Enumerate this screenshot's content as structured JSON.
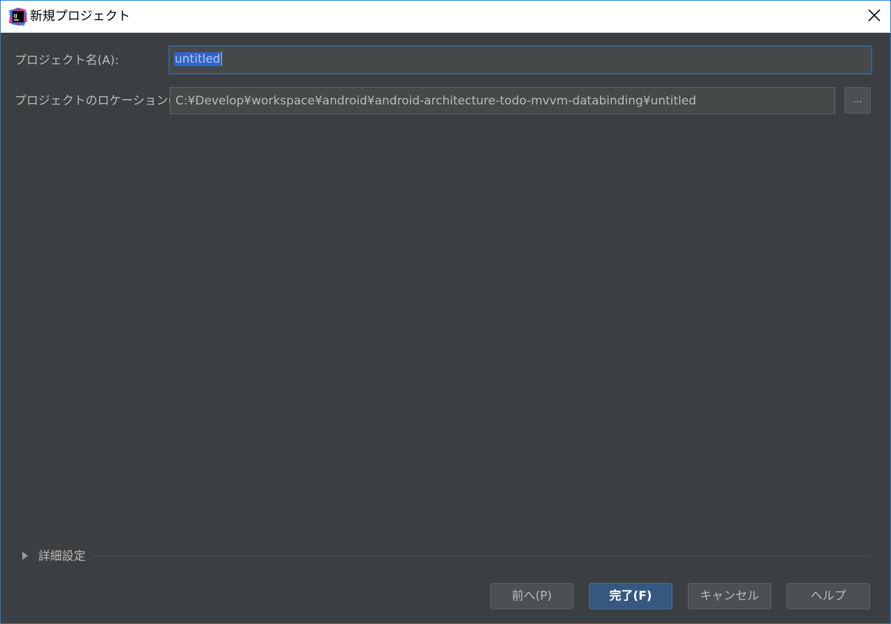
{
  "window": {
    "title": "新規プロジェクト",
    "app_icon_text": "IJ",
    "close_symbol": "✕"
  },
  "form": {
    "project_name": {
      "label": "プロジェクト名(A):",
      "value": "untitled"
    },
    "project_location": {
      "label": "プロジェクトのロケーション(L):",
      "value": "C:¥Develop¥workspace¥android¥android-architecture-todo-mvvm-databinding¥untitled",
      "browse_label": "..."
    }
  },
  "advanced": {
    "label": "詳細設定",
    "expanded": false
  },
  "buttons": {
    "previous": "前へ(P)",
    "finish": "完了(F)",
    "cancel": "キャンセル",
    "help": "ヘルプ"
  },
  "colors": {
    "background": "#3c3f41",
    "field_background": "#45494a",
    "focus_border": "#3d6185",
    "primary_button": "#365880",
    "selection": "#2f65ca",
    "window_border": "#1e7fd6"
  }
}
